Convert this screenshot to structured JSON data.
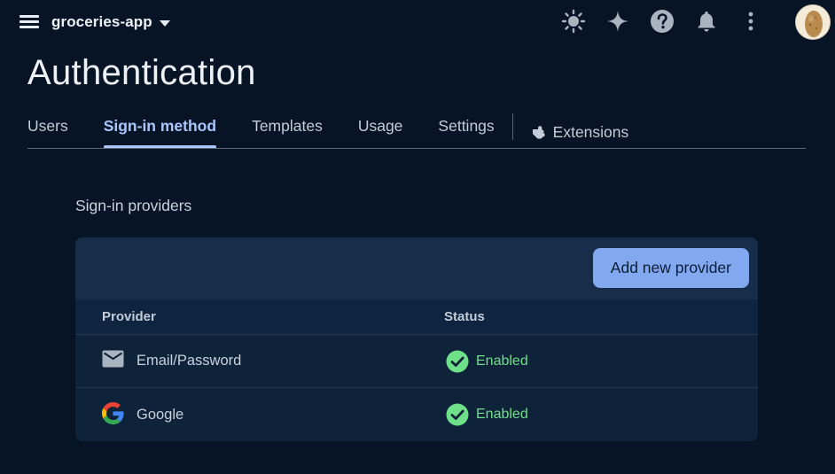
{
  "topbar": {
    "project_name": "groceries-app",
    "icons": [
      "menu-icon",
      "sun-icon",
      "sparkle-icon",
      "help-icon",
      "bell-icon",
      "more-vert-icon",
      "avatar"
    ]
  },
  "page": {
    "title": "Authentication"
  },
  "tabs": [
    {
      "label": "Users",
      "active": false
    },
    {
      "label": "Sign-in method",
      "active": true
    },
    {
      "label": "Templates",
      "active": false
    },
    {
      "label": "Usage",
      "active": false
    },
    {
      "label": "Settings",
      "active": false
    },
    {
      "label": "Extensions",
      "active": false,
      "icon": "extensions-icon"
    }
  ],
  "providers_section": {
    "title": "Sign-in providers",
    "add_button_label": "Add new provider",
    "columns": {
      "provider": "Provider",
      "status": "Status"
    },
    "rows": [
      {
        "provider": "Email/Password",
        "icon": "email-icon",
        "status": "Enabled"
      },
      {
        "provider": "Google",
        "icon": "google-icon",
        "status": "Enabled"
      }
    ]
  },
  "colors": {
    "background": "#061425",
    "accent": "#a9c7ff",
    "button": "#82a9f0",
    "enabled": "#6fe08a"
  }
}
